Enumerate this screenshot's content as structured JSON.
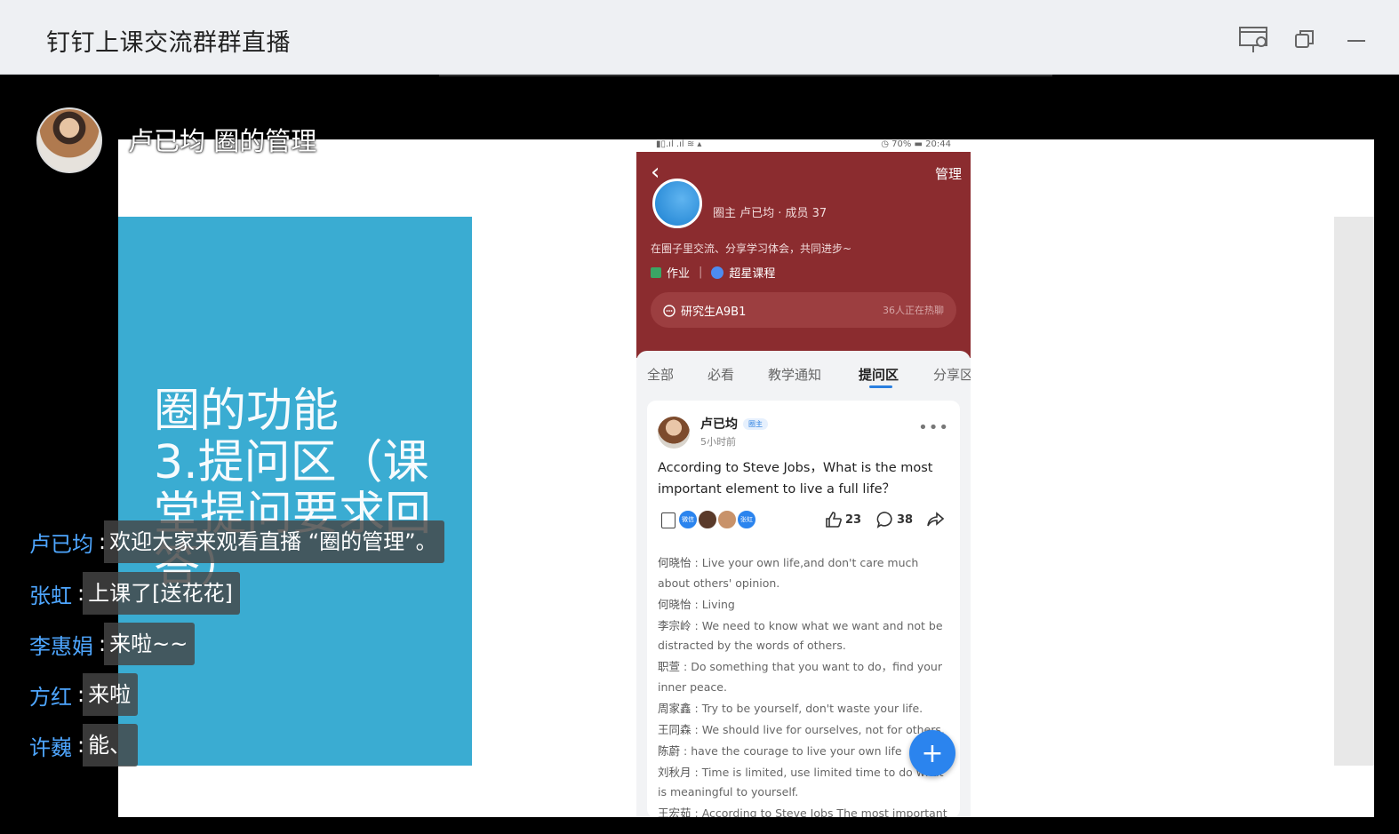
{
  "window": {
    "title": "钉钉上课交流群群直播",
    "buttons": [
      "screen-share-icon",
      "restore-icon",
      "minimize-icon"
    ]
  },
  "presenter": {
    "name_line": "卢已均 圈的管理"
  },
  "slide": {
    "lines": [
      "圈的功能",
      "3.提问区（课",
      "堂提问要求回",
      "答）"
    ]
  },
  "phone": {
    "status_left": "▮▯.ıl .ıl ≋ ▴",
    "status_right": "◷ 70% ▬ 20:44",
    "manage": "管理",
    "owner_info": "圈主 卢已均 · 成员 37",
    "description": "在圈子里交流、分享学习体会，共同进步~",
    "link_homework": "作业",
    "link_course": "超星课程",
    "group_name": "研究生A9B1",
    "group_chatting": "36人正在热聊",
    "tabs": [
      "全部",
      "必看",
      "教学通知",
      "提问区",
      "分享区"
    ],
    "active_tab": "提问区",
    "post": {
      "author": "卢已均",
      "badge": "圈主",
      "time": "5小时前",
      "question": "According to Steve Jobs，What is the most important element to live a full life？",
      "likes": "23",
      "comment_count": "38",
      "mini_avatar_labels": [
        "微信",
        "张虹"
      ],
      "comments": [
        {
          "name": "何晓怡",
          "text": "Live your own life,and don't care much about others' opinion."
        },
        {
          "name": "何晓怡",
          "text": "Living"
        },
        {
          "name": "李宗岭",
          "text": "We need to know what we want and not be distracted by the words of others."
        },
        {
          "name": "职萱",
          "text": "Do something that you want to do，find your inner peace."
        },
        {
          "name": "周家鑫",
          "text": "Try to be yourself, don't waste your life."
        },
        {
          "name": "王同森",
          "text": "We should live for ourselves, not for others."
        },
        {
          "name": "陈蔚",
          "text": "have the courage to live your own life"
        },
        {
          "name": "刘秋月",
          "text": "Time is limited, use limited time to do what is meaningful to yourself."
        },
        {
          "name": "王宏茹",
          "text": "According to Steve Jobs The most important"
        }
      ]
    },
    "fab": "+"
  },
  "chat": [
    {
      "name": "卢已均",
      "text": "欢迎大家来观看直播 “圈的管理”。"
    },
    {
      "name": "张虹",
      "text": "上课了[送花花]"
    },
    {
      "name": "李惠娟",
      "text": "来啦~~"
    },
    {
      "name": "方红",
      "text": "来啦"
    },
    {
      "name": "许巍",
      "text": "能、"
    }
  ],
  "colors": {
    "titlebar": "#eef0f3",
    "slide_bg": "#3aacd2",
    "phone_header": "#8b2c2f",
    "chat_name": "#4ea6ff",
    "accent_blue": "#2b84ee"
  }
}
